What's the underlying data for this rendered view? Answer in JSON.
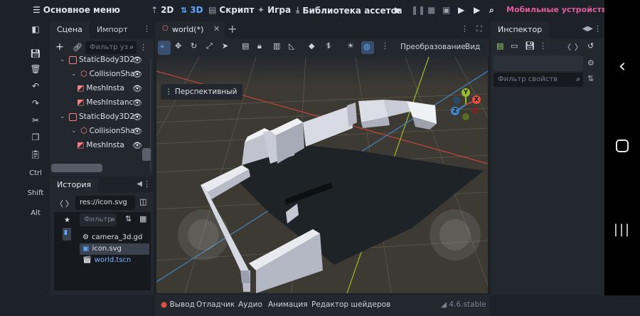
{
  "topbar": {
    "main_menu": "Основное меню",
    "btn_2d": "2D",
    "btn_3d": "3D",
    "script": "Скрипт",
    "game": "Игра",
    "asset_library": "Библиотека ассетов",
    "mobile": "Мобильные устройства"
  },
  "left_tools": {
    "ctrl": "Ctrl",
    "shift": "Shift",
    "alt": "Alt"
  },
  "scene_dock": {
    "tab_scene": "Сцена",
    "tab_import": "Импорт",
    "filter_placeholder": "Фильтр уз",
    "nodes": [
      {
        "label": "StaticBody3D2",
        "type": "body"
      },
      {
        "label": "CollisionSha",
        "type": "shape"
      },
      {
        "label": "MeshInsta",
        "type": "mesh"
      },
      {
        "label": "MeshInstanc",
        "type": "mesh"
      },
      {
        "label": "StaticBody3D2",
        "type": "body"
      },
      {
        "label": "CollisionSha",
        "type": "shape"
      },
      {
        "label": "MeshInsta",
        "type": "mesh"
      }
    ]
  },
  "history_dock": {
    "tab": "История",
    "path": "res://icon.svg",
    "filter_placeholder": "Фильтр",
    "files": [
      {
        "name": "camera_3d.gd",
        "icon": "gear-icon"
      },
      {
        "name": "icon.svg",
        "icon": "image-icon"
      },
      {
        "name": "world.tscn",
        "icon": "clapper-icon"
      }
    ]
  },
  "viewport": {
    "tab_label": "world(*)",
    "transform_menu": "Преобразование",
    "view_menu": "Вид",
    "perspective": "Перспективный",
    "gizmo": {
      "x": "X",
      "y": "Y",
      "z": "Z"
    }
  },
  "bottom_bar": {
    "output": "Вывод",
    "debugger": "Отладчик",
    "audio": "Аудио",
    "animation": "Анимация",
    "shader_editor": "Редактор шейдеров",
    "version": "4.6.stable"
  },
  "inspector": {
    "tab": "Инспектор",
    "filter_placeholder": "Фильтр свойств"
  },
  "colors": {
    "accent": "#5fa8ff",
    "mobile": "#e35b9c",
    "node_red": "#fc7f7f",
    "bg": "#1d2229",
    "panel": "#23282f"
  }
}
